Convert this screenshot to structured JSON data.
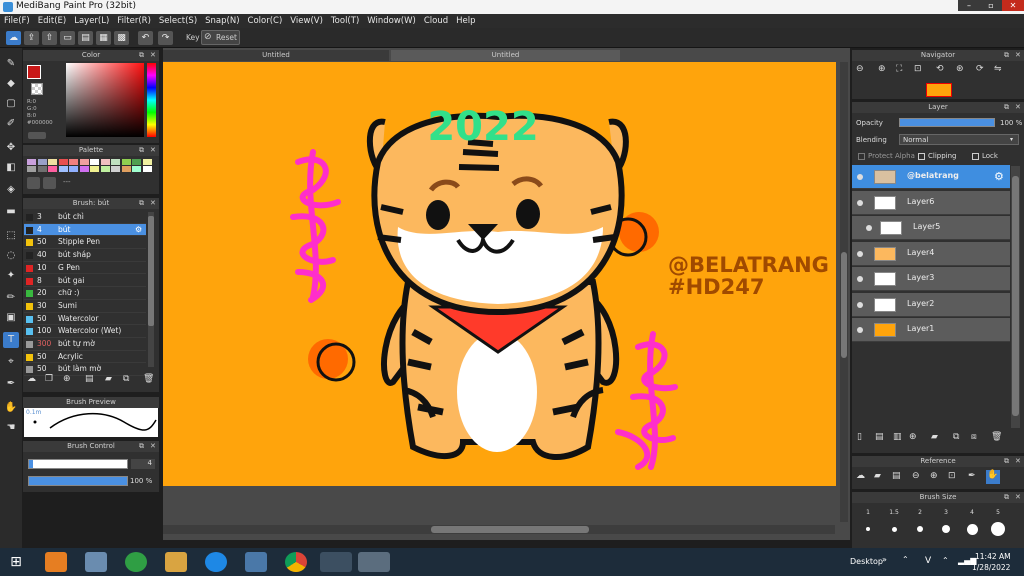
{
  "window": {
    "title": "MediBang Paint Pro (32bit)"
  },
  "menu": [
    "File(F)",
    "Edit(E)",
    "Layer(L)",
    "Filter(R)",
    "Select(S)",
    "Snap(N)",
    "Color(C)",
    "View(V)",
    "Tool(T)",
    "Window(W)",
    "Cloud",
    "Help"
  ],
  "toolbar": {
    "key_label": "Key",
    "reset_label": "Reset"
  },
  "tabs": [
    "Untitled",
    "Untitled"
  ],
  "color_panel": {
    "title": "Color",
    "r": "R:0",
    "g": "G:0",
    "b": "B:0",
    "hex": "#000000",
    "fg": "#c81818"
  },
  "palette_panel": {
    "title": "Palette",
    "swatches": [
      "#c9a0dc",
      "#9aa0c8",
      "#f0e0a0",
      "#e85050",
      "#f08080",
      "#f0a0a0",
      "#ffffff",
      "#f0c0c0",
      "#c0e0c0",
      "#90d050",
      "#50a050",
      "#f0f0a0",
      "#a0a0a0",
      "#707070",
      "#ff60a0",
      "#a0c0ff",
      "#90b0ff",
      "#d070f0",
      "#f0f090",
      "#c0f0a0",
      "#d0d0d0",
      "#e0a060",
      "#a0ffd0",
      "#ffffff"
    ],
    "more": "---"
  },
  "brush_panel": {
    "title": "Brush: bút",
    "brushes": [
      {
        "size": "3",
        "name": "bút chì",
        "color": "#222222"
      },
      {
        "size": "4",
        "name": "bút",
        "color": "#222222"
      },
      {
        "size": "50",
        "name": "Stipple Pen",
        "color": "#f2c20c"
      },
      {
        "size": "40",
        "name": "bút sháp",
        "color": "#222222"
      },
      {
        "size": "10",
        "name": "G Pen",
        "color": "#e02424"
      },
      {
        "size": "8",
        "name": "bút gai",
        "color": "#e02424"
      },
      {
        "size": "20",
        "name": "chữ :)",
        "color": "#39b83f"
      },
      {
        "size": "30",
        "name": "Sumi",
        "color": "#f2c20c"
      },
      {
        "size": "50",
        "name": "Watercolor",
        "color": "#58c0f0"
      },
      {
        "size": "100",
        "name": "Watercolor (Wet)",
        "color": "#58c0f0"
      },
      {
        "size": "300",
        "name": "bút tự mờ",
        "color": "#999999"
      },
      {
        "size": "50",
        "name": "Acrylic",
        "color": "#f2c20c"
      },
      {
        "size": "50",
        "name": "bút làm mờ",
        "color": "#999999"
      }
    ]
  },
  "brush_preview": {
    "title": "Brush Preview",
    "size_text": "0.1m"
  },
  "brush_control": {
    "title": "Brush Control",
    "size_value": "4",
    "opacity_value": "100 %"
  },
  "navigator": {
    "title": "Navigator"
  },
  "layer_panel": {
    "title": "Layer",
    "opacity_label": "Opacity",
    "opacity_value": "100 %",
    "blending_label": "Blending",
    "blending_value": "Normal",
    "protect_alpha": "Protect Alpha",
    "clipping": "Clipping",
    "lock": "Lock",
    "layers": [
      "@belatrang",
      "Layer6",
      "Layer5",
      "Layer4",
      "Layer3",
      "Layer2",
      "Layer1"
    ]
  },
  "reference": {
    "title": "Reference"
  },
  "brush_size": {
    "title": "Brush Size",
    "sizes": [
      "1",
      "1.5",
      "2",
      "3",
      "4",
      "5"
    ]
  },
  "artwork": {
    "year": "2022",
    "handle": "@BELATRANG",
    "hashtag": "#HD247",
    "bg": "#ffa40c"
  },
  "taskbar": {
    "desktop_label": "Desktop",
    "lang": "V",
    "time": "11:42 AM",
    "date": "1/28/2022"
  }
}
